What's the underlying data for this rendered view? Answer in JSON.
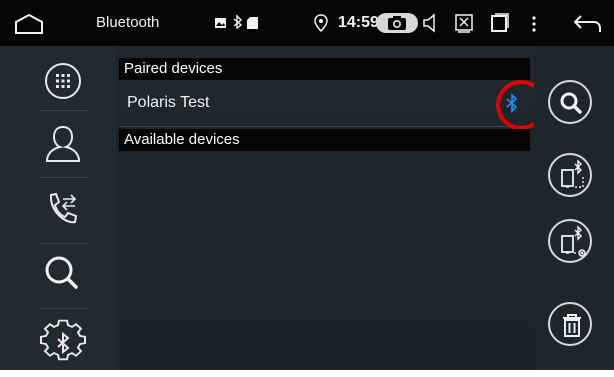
{
  "statusbar": {
    "title": "Bluetooth",
    "time": "14:59",
    "icons": [
      "home-icon",
      "image-notification-icon",
      "bluetooth-status-icon",
      "sd-card-icon",
      "location-icon",
      "camera-icon",
      "volume-icon",
      "screenshot-icon",
      "recent-apps-icon",
      "overflow-menu-icon",
      "back-icon"
    ]
  },
  "sidebar": {
    "items": [
      {
        "name": "dialpad",
        "icon": "dialpad-icon"
      },
      {
        "name": "contacts",
        "icon": "contact-icon"
      },
      {
        "name": "call-log",
        "icon": "call-transfer-icon"
      },
      {
        "name": "search",
        "icon": "search-icon"
      },
      {
        "name": "bluetooth-settings",
        "icon": "bluetooth-settings-icon"
      }
    ]
  },
  "lists": {
    "paired_header": "Paired devices",
    "paired": [
      {
        "name": "Polaris Test",
        "status_icon": "bluetooth-icon",
        "highlighted": true
      }
    ],
    "available_header": "Available devices"
  },
  "actions": [
    {
      "name": "search-devices",
      "icon": "search-icon"
    },
    {
      "name": "connect-device",
      "icon": "phone-bluetooth-connect-icon"
    },
    {
      "name": "disconnect-device",
      "icon": "phone-bluetooth-disconnect-icon"
    },
    {
      "name": "delete-device",
      "icon": "trash-icon"
    }
  ],
  "colors": {
    "highlight": "#e00000",
    "bluetooth_accent": "#1e90ff",
    "background": "#1c242b",
    "bar": "#050505"
  }
}
